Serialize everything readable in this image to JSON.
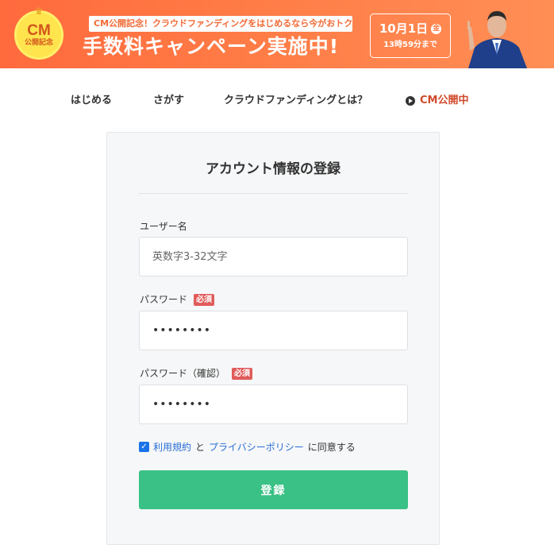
{
  "banner": {
    "badge_main": "CM",
    "badge_sub": "公開記念",
    "subtitle": "CM公開記念！クラウドファンディングをはじめるなら今がおトク",
    "title": "手数料キャンペーン実施中!",
    "countdown_date": "10月1日",
    "countdown_day": "金",
    "countdown_remaining": "13時59分まで"
  },
  "nav": {
    "items": [
      "はじめる",
      "さがす",
      "クラウドファンディングとは？"
    ],
    "cm_label": "CM公開中"
  },
  "form": {
    "title": "アカウント情報の登録",
    "username_label": "ユーザー名",
    "username_placeholder": "英数字3-32文字",
    "password_label": "パスワード",
    "password_required": "必須",
    "password_value": "••••••••",
    "password_confirm_label": "パスワード（確認）",
    "password_confirm_required": "必須",
    "password_confirm_value": "••••••••",
    "agree_terms_link": "利用規約",
    "agree_and": "と",
    "agree_privacy_link": "プライバシーポリシー",
    "agree_suffix": "に同意する",
    "agree_checked": true,
    "submit_label": "登録"
  },
  "colors": {
    "banner_orange": "#ff6a3d",
    "submit_green": "#3ac185",
    "required_red": "#e05b5b",
    "link_blue": "#2a6fd6"
  }
}
